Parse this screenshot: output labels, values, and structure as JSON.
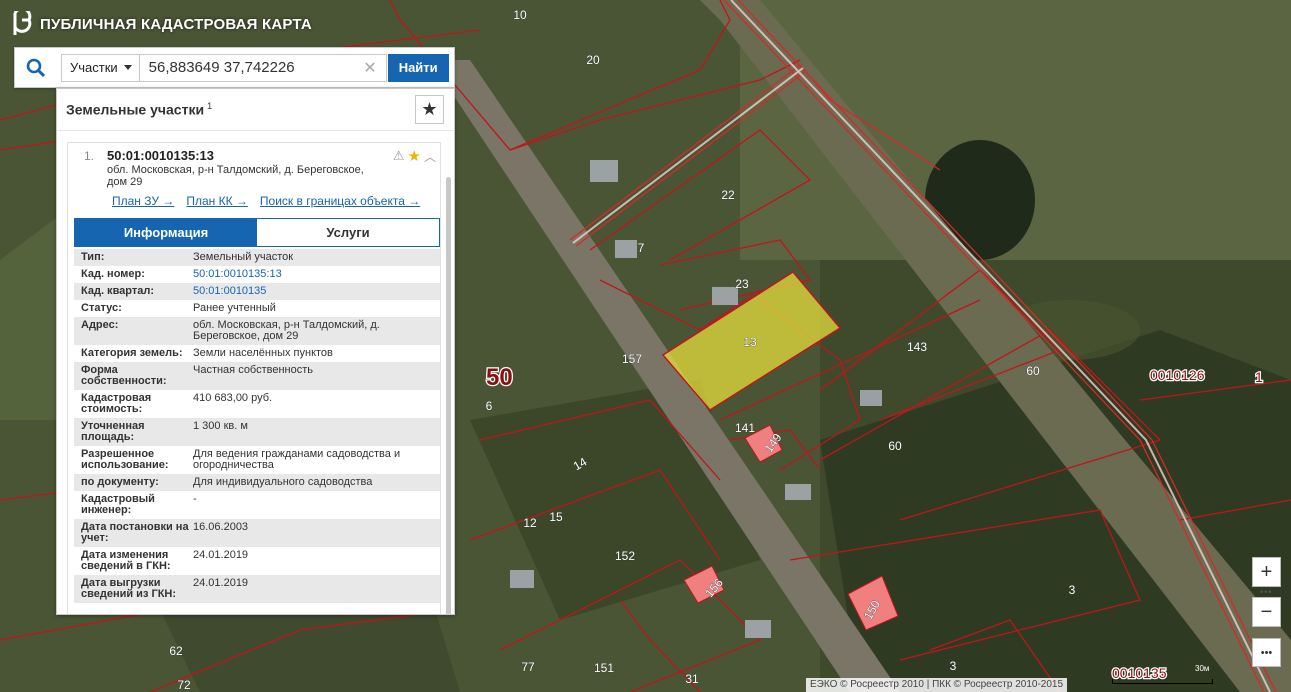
{
  "app": {
    "title": "ПУБЛИЧНАЯ КАДАСТРОВАЯ КАРТА"
  },
  "search": {
    "type_label": "Участки",
    "query": "56,883649 37,742226",
    "clear_glyph": "✕",
    "find_label": "Найти"
  },
  "panel": {
    "title": "Земельные участки",
    "count": "1"
  },
  "card": {
    "index": "1.",
    "cad_number": "50:01:0010135:13",
    "address": "обл. Московская, р-н Талдомский, д. Береговское, дом 29",
    "links": [
      "План ЗУ →",
      "План КК →",
      "Поиск в границах объекта →"
    ],
    "tabs": [
      "Информация",
      "Услуги"
    ]
  },
  "info": [
    {
      "key": "Тип:",
      "value": "Земельный участок"
    },
    {
      "key": "Кад. номер:",
      "value": "50:01:0010135:13"
    },
    {
      "key": "Кад. квартал:",
      "value": "50:01:0010135"
    },
    {
      "key": "Статус:",
      "value": "Ранее учтенный"
    },
    {
      "key": "Адрес:",
      "value": "обл. Московская, р-н Талдомский, д. Береговское, дом 29"
    },
    {
      "key": "Категория земель:",
      "value": "Земли населённых пунктов"
    },
    {
      "key": "Форма собственности:",
      "value": "Частная собственность"
    },
    {
      "key": "Кадастровая стоимость:",
      "value": "410 683,00 руб."
    },
    {
      "key": "Уточненная площадь:",
      "value": "1 300 кв. м"
    },
    {
      "key": "Разрешенное использование:",
      "value": "Для ведения гражданами садоводства и огородничества"
    },
    {
      "key": "по документу:",
      "value": "Для индивидуального садоводства"
    },
    {
      "key": "Кадастровый инженер:",
      "value": "-"
    },
    {
      "key": "Дата постановки на учет:",
      "value": "16.06.2003"
    },
    {
      "key": "Дата изменения сведений в ГКН:",
      "value": "24.01.2019"
    },
    {
      "key": "Дата выгрузки сведений из ГКН:",
      "value": "24.01.2019"
    }
  ],
  "map": {
    "parcel_labels": [
      "10",
      "20",
      "22",
      "7",
      "23",
      "13",
      "143",
      "60",
      "60",
      "157",
      "141",
      "149",
      "14",
      "12",
      "15",
      "152",
      "156",
      "150",
      "3",
      "3",
      "77",
      "151",
      "31",
      "62",
      "72",
      "6"
    ],
    "region_label": "50",
    "quarter_labels": [
      "0010126",
      "1",
      "0010135"
    ],
    "scale_text": "30м",
    "attribution": "ЕЭКО © Росреестр 2010 | ПКК © Росреестр 2010-2015"
  },
  "controls": {
    "zoom_in": "+",
    "zoom_out": "−",
    "more": "•••"
  },
  "colors": {
    "brand_blue": "#1565b0",
    "parcel_border": "#c0151b",
    "selected_fill": "#e6dc3c",
    "highlight_fill": "#f08080"
  }
}
